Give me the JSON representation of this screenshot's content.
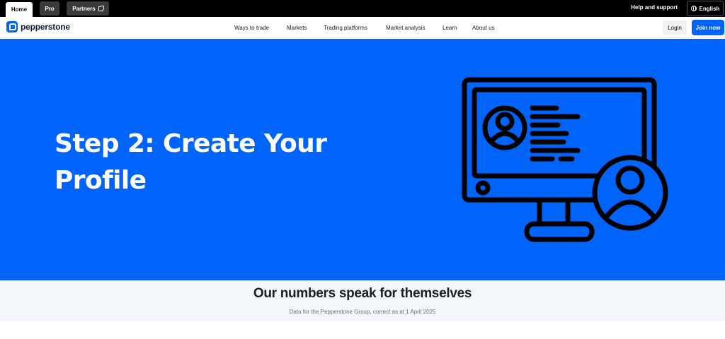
{
  "topbar": {
    "tabs": [
      {
        "label": "Home"
      },
      {
        "label": "Pro"
      },
      {
        "label": "Partners"
      }
    ],
    "help_label": "Help and support",
    "language_label": "English"
  },
  "nav": {
    "logo_text": "pepperstone",
    "links": [
      "Ways to trade",
      "Markets",
      "Trading platforms",
      "Market analysis",
      "Learn",
      "About us"
    ],
    "login_label": "Login",
    "join_label": "Join now"
  },
  "hero": {
    "title_line1": "Step 2: Create Your",
    "title_line2": "Profile",
    "illustration_icon": "computer-profile-icon"
  },
  "numbers": {
    "title": "Our numbers speak for themselves",
    "subtitle": "Data for the Pepperstone Group, correct as at 1 April 2025"
  },
  "colors": {
    "brand_blue": "#0064fa",
    "topbar_bg": "#000000",
    "numbers_bg": "#f3f6fb"
  }
}
